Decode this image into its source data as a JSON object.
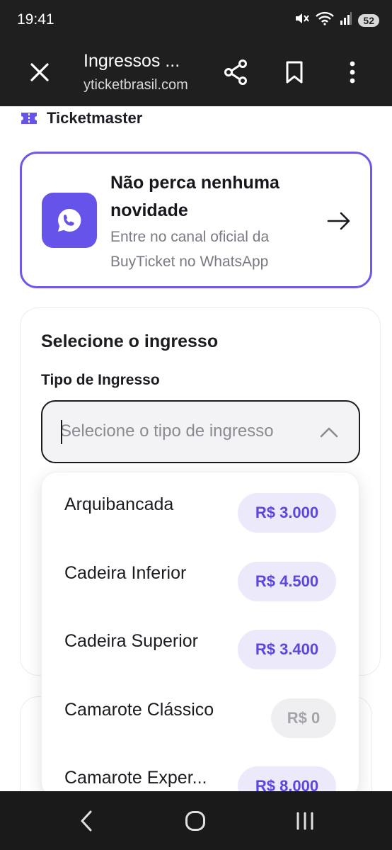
{
  "status_bar": {
    "time": "19:41",
    "battery": "52",
    "icons": [
      "mute-icon",
      "wifi-icon",
      "signal-icon",
      "battery-icon"
    ]
  },
  "browser": {
    "tab_title": "Ingressos ...",
    "url": "yticketbrasil.com",
    "icons": [
      "close-icon",
      "share-icon",
      "bookmark-icon",
      "more-vert-icon"
    ]
  },
  "page": {
    "brand": "Ticketmaster",
    "brand_icon": "ticket-icon",
    "promo": {
      "title": "Não perca nenhuma novidade",
      "subtitle": "Entre no canal oficial da BuyTicket no WhatsApp",
      "icon": "whatsapp-icon",
      "arrow_icon": "arrow-right-icon"
    },
    "selection": {
      "heading": "Selecione o ingresso",
      "field_label": "Tipo de Ingresso",
      "placeholder": "Selecione o tipo de ingresso",
      "chevron_icon": "chevron-up-icon"
    },
    "dropdown_options": [
      {
        "name": "Arquibancada",
        "price": "R$ 3.000",
        "available": true
      },
      {
        "name": "Cadeira Inferior",
        "price": "R$ 4.500",
        "available": true
      },
      {
        "name": "Cadeira Superior",
        "price": "R$ 3.400",
        "available": true
      },
      {
        "name": "Camarote Clássico",
        "price": "R$ 0",
        "available": false
      },
      {
        "name": "Camarote Exper...",
        "price": "R$ 8.000",
        "available": true
      }
    ]
  },
  "colors": {
    "accent": "#6654ea",
    "pill_bg": "#ece9fb",
    "pill_text": "#5a48de",
    "dark_bar": "#1f1f1f"
  },
  "nav_bar": {
    "icons": [
      "back-icon",
      "home-icon",
      "recents-icon"
    ]
  }
}
